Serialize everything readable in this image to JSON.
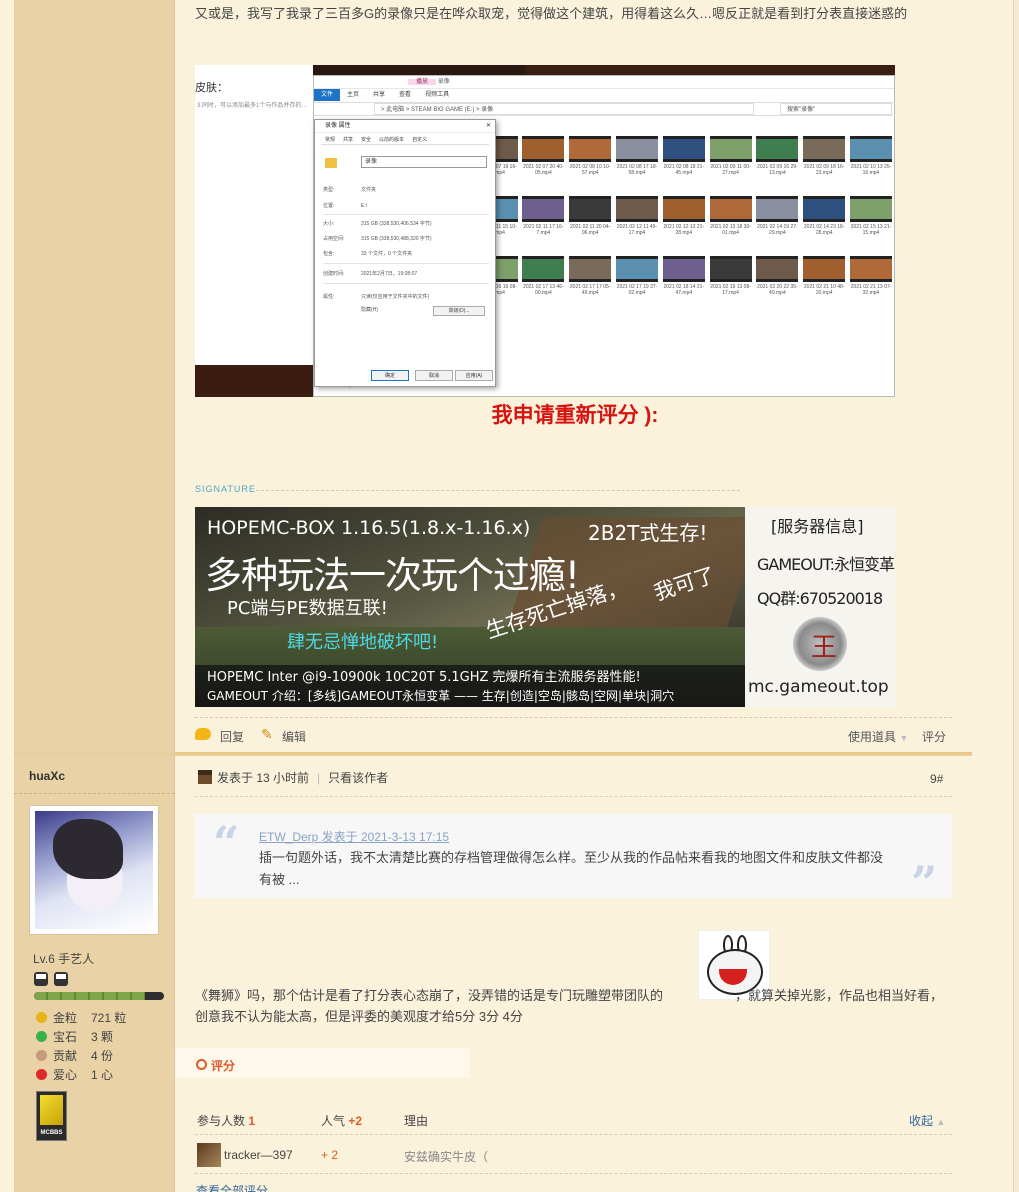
{
  "post_intro": "又或是，我写了我录了三百多G的录像只是在哗众取宠，觉得做这个建筑，用得着这么久…嗯反正就是看到打分表直接迷惑的",
  "screenshot": {
    "left_label": "皮肤：",
    "left_note": "3.同时，可以添加最多1个与作品并存的…",
    "explorer_title_hl": "播放",
    "explorer_title_rest": "录像",
    "ribbon": [
      "文件",
      "主页",
      "共享",
      "查看",
      "视频工具"
    ],
    "path": "> 此电脑 > STEAM BIG GAME (E:) > 录像",
    "search_placeholder": "搜索\"录像\"",
    "status": "DESKTOP-Q8O",
    "thumbs": [
      "2021 02 07 15 30-08.mp4",
      "2021 02 07 16 50-14.mp4",
      "2021 02 07 19 16-16.mp4",
      "2021 02 07 20 40-05.mp4",
      "2021 02 08 10 10-57.mp4",
      "2021 02 08 17 18-58.mp4",
      "2021 02 08 18 21-45.mp4",
      "2021 02 09 11 00-27.mp4",
      "2021 02 09 16 29-13.mp4",
      "2021 02 09 18 16-23.mp4",
      "2021 02 10 13 25-16.mp4",
      "2021 02 10 16 31-17.mp4",
      "2021 02 10 17 11-03.mp4",
      "2021 02 11 15 10-74.mp4",
      "2021 02 11 17 16-7.mp4",
      "2021 02 11 20 04-06.mp4",
      "2021 02 12 11 49-17.mp4",
      "2021 02 12 12 21-28.mp4",
      "2021 02 13 18 30-01.mp4",
      "2021 02 14 19 27-29.mp4",
      "2021 02 14 23 18-28.mp4",
      "2021 02 15 13 21-15.mp4",
      "2021 02 15 20 20-57.mp4",
      "2021 02 16 11 18-58.mp4",
      "2021 02 16 16 08-23.mp4",
      "2021 02 17 13 46-00.mp4",
      "2021 02 17 17 05-49.mp4",
      "2021 02 17 19 37-02.mp4",
      "2021 02 18 14 21-47.mp4",
      "2021 02 19 13 08-17.mp4",
      "2021 02 20 22 35-49.mp4",
      "2021 02 21 10 48-20.mp4",
      "2021 02 21 13 07-32.mp4"
    ],
    "props": {
      "title": "录像 属性",
      "tabs": [
        "常规",
        "共享",
        "安全",
        "以前的版本",
        "自定义"
      ],
      "name": "录像",
      "rows": [
        {
          "k": "类型:",
          "v": "文件夹"
        },
        {
          "k": "位置:",
          "v": "E:\\"
        },
        {
          "k": "大小:",
          "v": "315 GB (338,530,406,534 字节)"
        },
        {
          "k": "占用空间:",
          "v": "315 GB (338,530,488,320 字节)"
        },
        {
          "k": "包含:",
          "v": "33 个文件，0 个文件夹"
        },
        {
          "k": "创建时间:",
          "v": "2021年2月7日，19:08:07"
        },
        {
          "k": "属性:",
          "v": "只读(仅应用于文件夹中的文件)"
        },
        {
          "k": "",
          "v": "隐藏(H)"
        }
      ],
      "advanced": "高级(D)...",
      "buttons": [
        "确定",
        "取消",
        "应用(A)"
      ]
    }
  },
  "rerate_text": "我申请重新评分 ):",
  "signature_label": "SIGNATURE",
  "banner": {
    "line1": "HOPEMC-BOX 1.16.5(1.8.x-1.16.x)",
    "line1b": "2B2T式生存!",
    "big": "多种玩法一次玩个过瘾!",
    "pc": "PC端与PE数据互联!",
    "cyan": "肆无忌惮地破坏吧!",
    "diag1": "生存死亡掉落，",
    "diag2": "我可了",
    "cpu": "HOPEMC  Inter @i9-10900k 10C20T 5.1GHZ 完爆所有主流服务器性能!",
    "gameout": "GAMEOUT 介绍：[多线]GAMEOUT永恒变革 —— 生存|创造|空岛|骸岛|空网|单块|洞穴",
    "right_title": "[服务器信息]",
    "right_gameout": "GAMEOUT:永恒变革",
    "right_qq": "QQ群:670520018",
    "right_url": "mc.gameout.top",
    "seal": "王"
  },
  "actions": {
    "reply": "回复",
    "edit": "编辑",
    "tools": "使用道具",
    "rate": "评分"
  },
  "author": {
    "name": "huaXc",
    "level": "Lv.6 手艺人",
    "progress": 0.85,
    "stats": [
      {
        "k": "金粒",
        "v": "721 粒",
        "color": "#e7b417"
      },
      {
        "k": "宝石",
        "v": "3 颗",
        "color": "#38b148"
      },
      {
        "k": "贡献",
        "v": "4 份",
        "color": "#c59a7e"
      },
      {
        "k": "爱心",
        "v": "1 心",
        "color": "#e02a2a"
      }
    ],
    "medal": "MCBBS"
  },
  "post2": {
    "posted": "发表于 13 小时前",
    "only_author": "只看该作者",
    "floor": "9#",
    "quote_src": "ETW_Derp 发表于 2021-3-13 17:15",
    "quote_text": "插一句题外话，我不太清楚比赛的存档管理做得怎么样。至少从我的作品帖来看我的地图文件和皮肤文件都没有被 ...",
    "body_a": "《舞狮》吗，那个估计是看了打分表心态崩了，没弄错的话是专门玩雕塑带团队的",
    "body_b": "，就算关掉光影，作品也相当好看，创意我不认为能太高，但是评委的美观度才给5分 3分 4分"
  },
  "rating": {
    "label": "评分",
    "participants_label": "参与人数",
    "participants": "1",
    "popularity_label": "人气",
    "popularity": "+2",
    "reason_label": "理由",
    "collapse": "收起",
    "rows": [
      {
        "user": "tracker—397",
        "score": "+ 2",
        "reason": "安兹确实牛皮（"
      }
    ],
    "more": "查看全部评分"
  }
}
